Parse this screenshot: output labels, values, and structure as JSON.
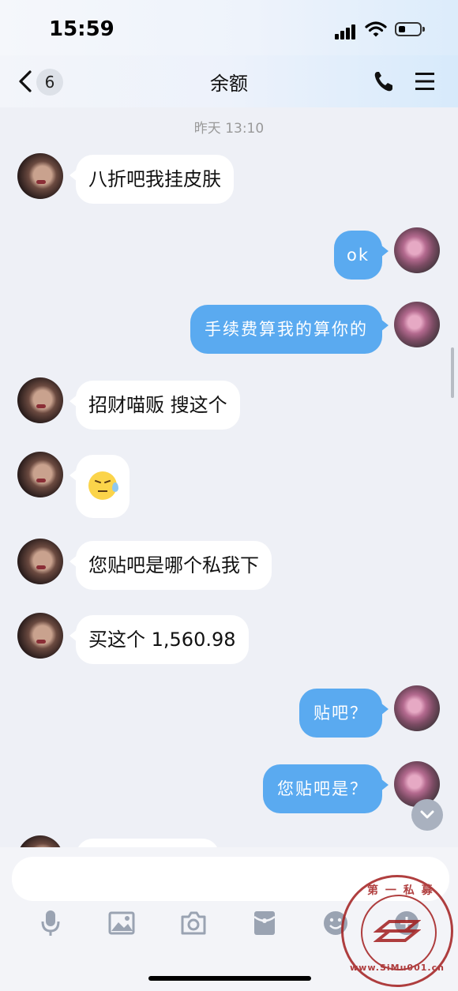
{
  "status": {
    "time": "15:59"
  },
  "header": {
    "badge": "6",
    "title": "余额"
  },
  "chat": {
    "timestamp": "昨天 13:10",
    "messages": [
      {
        "side": "in",
        "text": "八折吧我挂皮肤"
      },
      {
        "side": "out",
        "text": "ok"
      },
      {
        "side": "out",
        "text": "手续费算我的算你的"
      },
      {
        "side": "in",
        "text": "招财喵贩 搜这个"
      },
      {
        "side": "in",
        "text": "",
        "emoji": "sweat-smile-emoji"
      },
      {
        "side": "in",
        "text": "您贴吧是哪个私我下"
      },
      {
        "side": "in",
        "text": "买这个 1,560.98"
      },
      {
        "side": "out",
        "text": "贴吧？"
      },
      {
        "side": "out",
        "text": "您贴吧是？"
      }
    ]
  },
  "input": {
    "placeholder": ""
  },
  "toolbar": {
    "icons": [
      "microphone-icon",
      "image-icon",
      "camera-icon",
      "red-packet-icon",
      "emoji-icon",
      "more-icon"
    ]
  },
  "watermark": {
    "top_text": "第 一 私 募",
    "url_text": "www.SiMu001.cn"
  }
}
